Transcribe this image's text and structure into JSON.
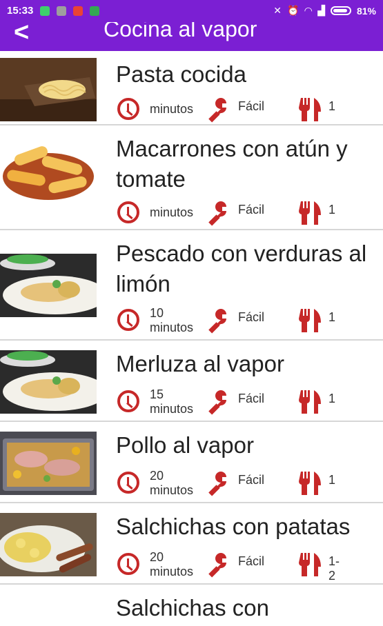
{
  "status_bar": {
    "time": "15:33",
    "battery": "81%"
  },
  "app_bar": {
    "back_label": "<",
    "title": "Cocina al vapor"
  },
  "recipes": [
    {
      "name": "Pasta cocida",
      "time": "minutos",
      "difficulty": "Fácil",
      "servings": "1"
    },
    {
      "name": "Macarrones con atún y tomate",
      "time": "minutos",
      "difficulty": "Fácil",
      "servings": "1"
    },
    {
      "name": "Pescado con verduras al limón",
      "time": "10 minutos",
      "difficulty": "Fácil",
      "servings": "1"
    },
    {
      "name": "Merluza al vapor",
      "time": "15 minutos",
      "difficulty": "Fácil",
      "servings": "1"
    },
    {
      "name": "Pollo al vapor",
      "time": "20 minutos",
      "difficulty": "Fácil",
      "servings": "1"
    },
    {
      "name": "Salchichas con patatas",
      "time": "20 minutos",
      "difficulty": "Fácil",
      "servings": "1-2"
    },
    {
      "name": "Salchichas con",
      "time": "",
      "difficulty": "",
      "servings": ""
    }
  ],
  "colors": {
    "primary": "#7b1fd3",
    "icon": "#c62828"
  }
}
